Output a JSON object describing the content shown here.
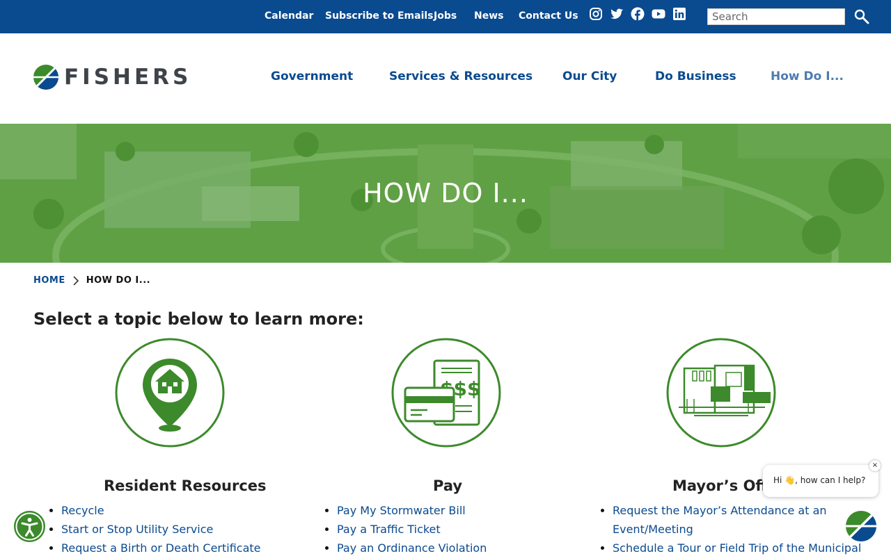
{
  "utility_nav": {
    "links": [
      "Calendar",
      "Subscribe to Emails",
      "Jobs",
      "News",
      "Contact Us"
    ],
    "social_icons": [
      "instagram-icon",
      "twitter-icon",
      "facebook-icon",
      "youtube-icon",
      "linkedin-icon"
    ],
    "search_placeholder": "Search"
  },
  "header": {
    "logo_text": "FISHERS",
    "nav": [
      "Government",
      "Services & Resources",
      "Our City",
      "Do Business",
      "How Do I..."
    ],
    "active_nav": "How Do I..."
  },
  "hero": {
    "title": "HOW DO I..."
  },
  "breadcrumb": {
    "home": "HOME",
    "current": "HOW DO I..."
  },
  "intro": "Select a topic below to learn more:",
  "topics": [
    {
      "title": "Resident Resources",
      "icon": "home-location-pin-icon",
      "links": [
        "Recycle",
        "Start or Stop Utility Service",
        "Request a Birth or Death Certificate"
      ]
    },
    {
      "title": "Pay",
      "icon": "bill-and-credit-card-icon",
      "links": [
        "Pay My Stormwater Bill",
        "Pay a Traffic Ticket",
        "Pay an Ordinance Violation"
      ]
    },
    {
      "title": "Mayor’s Office",
      "icon": "municipal-buildings-icon",
      "links": [
        "Request the Mayor’s Attendance at an Event/Meeting",
        "Schedule a Tour or Field Trip of the Municipal"
      ]
    }
  ],
  "chat": {
    "greeting": "Hi 👋, how can I help?",
    "close": "×"
  },
  "colors": {
    "brand_blue": "#0a4a8f",
    "brand_green": "#3c8a2b",
    "hero_tint": "#5f9a4a"
  }
}
